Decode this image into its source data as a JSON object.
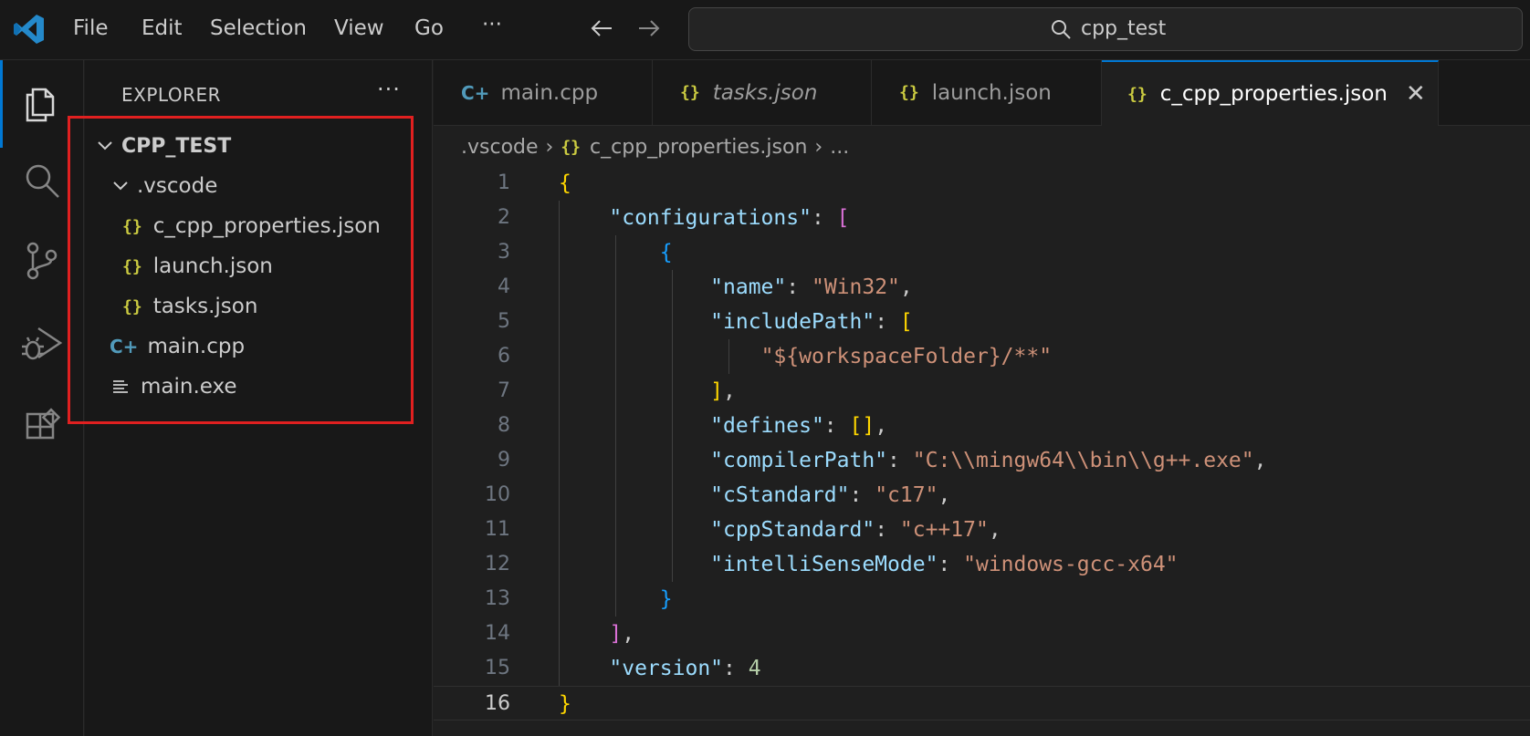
{
  "titlebar": {
    "menu": [
      "File",
      "Edit",
      "Selection",
      "View",
      "Go",
      "···"
    ],
    "search_text": "cpp_test"
  },
  "explorer": {
    "title": "EXPLORER",
    "more": "···",
    "root": "CPP_TEST",
    "folder": ".vscode",
    "folder_files": [
      "c_cpp_properties.json",
      "launch.json",
      "tasks.json"
    ],
    "files": [
      "main.cpp",
      "main.exe"
    ]
  },
  "tabs": [
    {
      "label": "main.cpp",
      "icon": "cpp-icon",
      "italic": false
    },
    {
      "label": "tasks.json",
      "icon": "json-icon",
      "italic": true
    },
    {
      "label": "launch.json",
      "icon": "json-icon",
      "italic": false
    },
    {
      "label": "c_cpp_properties.json",
      "icon": "json-icon",
      "italic": false,
      "active": true
    }
  ],
  "icons": {
    "json": "{}",
    "cpp": "C+",
    "close": "✕"
  },
  "breadcrumb": {
    "folder": ".vscode",
    "file": "c_cpp_properties.json",
    "more": "..."
  },
  "editor": {
    "active_line": 16,
    "line_numbers": [
      "1",
      "2",
      "3",
      "4",
      "5",
      "6",
      "7",
      "8",
      "9",
      "10",
      "11",
      "12",
      "13",
      "14",
      "15",
      "16"
    ],
    "lines": [
      [
        [
          "{",
          "brace-y"
        ]
      ],
      [
        [
          "    ",
          "punc"
        ],
        [
          "\"configurations\"",
          "key"
        ],
        [
          ": ",
          "punc"
        ],
        [
          "[",
          "brace-p"
        ]
      ],
      [
        [
          "        ",
          "punc"
        ],
        [
          "{",
          "brace-b"
        ]
      ],
      [
        [
          "            ",
          "punc"
        ],
        [
          "\"name\"",
          "key"
        ],
        [
          ": ",
          "punc"
        ],
        [
          "\"Win32\"",
          "str"
        ],
        [
          ",",
          "punc"
        ]
      ],
      [
        [
          "            ",
          "punc"
        ],
        [
          "\"includePath\"",
          "key"
        ],
        [
          ": ",
          "punc"
        ],
        [
          "[",
          "brace-y"
        ]
      ],
      [
        [
          "                ",
          "punc"
        ],
        [
          "\"${workspaceFolder}/**\"",
          "str"
        ]
      ],
      [
        [
          "            ",
          "punc"
        ],
        [
          "]",
          "brace-y"
        ],
        [
          ",",
          "punc"
        ]
      ],
      [
        [
          "            ",
          "punc"
        ],
        [
          "\"defines\"",
          "key"
        ],
        [
          ": ",
          "punc"
        ],
        [
          "[]",
          "brace-y"
        ],
        [
          ",",
          "punc"
        ]
      ],
      [
        [
          "            ",
          "punc"
        ],
        [
          "\"compilerPath\"",
          "key"
        ],
        [
          ": ",
          "punc"
        ],
        [
          "\"C:\\\\mingw64\\\\bin\\\\g++.exe\"",
          "str"
        ],
        [
          ",",
          "punc"
        ]
      ],
      [
        [
          "            ",
          "punc"
        ],
        [
          "\"cStandard\"",
          "key"
        ],
        [
          ": ",
          "punc"
        ],
        [
          "\"c17\"",
          "str"
        ],
        [
          ",",
          "punc"
        ]
      ],
      [
        [
          "            ",
          "punc"
        ],
        [
          "\"cppStandard\"",
          "key"
        ],
        [
          ": ",
          "punc"
        ],
        [
          "\"c++17\"",
          "str"
        ],
        [
          ",",
          "punc"
        ]
      ],
      [
        [
          "            ",
          "punc"
        ],
        [
          "\"intelliSenseMode\"",
          "key"
        ],
        [
          ": ",
          "punc"
        ],
        [
          "\"windows-gcc-x64\"",
          "str"
        ]
      ],
      [
        [
          "        ",
          "punc"
        ],
        [
          "}",
          "brace-b"
        ]
      ],
      [
        [
          "    ",
          "punc"
        ],
        [
          "]",
          "brace-p"
        ],
        [
          ",",
          "punc"
        ]
      ],
      [
        [
          "    ",
          "punc"
        ],
        [
          "\"version\"",
          "key"
        ],
        [
          ": ",
          "punc"
        ],
        [
          "4",
          "num"
        ]
      ],
      [
        [
          "}",
          "brace-y"
        ]
      ]
    ]
  },
  "colors": {
    "accent": "#0078d4",
    "highlight_box": "#e02020"
  }
}
